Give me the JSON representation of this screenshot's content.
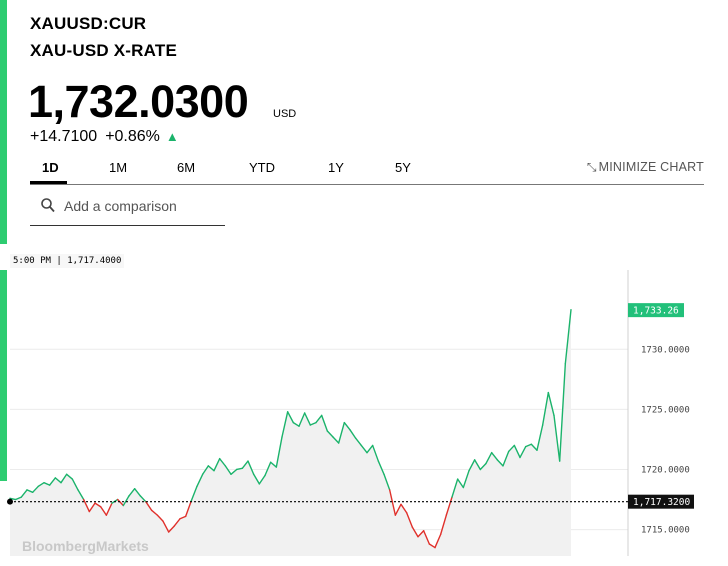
{
  "header": {
    "ticker": "XAUUSD:CUR",
    "name": "XAU-USD X-RATE",
    "price": "1,732.0300",
    "currency": "USD",
    "change": "+14.7100",
    "change_pct": "+0.86%"
  },
  "tabs": [
    {
      "label": "1D",
      "active": true
    },
    {
      "label": "1M"
    },
    {
      "label": "6M"
    },
    {
      "label": "YTD"
    },
    {
      "label": "1Y"
    },
    {
      "label": "5Y"
    }
  ],
  "minimize_chart": "MINIMIZE CHART",
  "compare": {
    "placeholder": "Add a comparison",
    "icon": "search-icon"
  },
  "hover": {
    "time": "5:00 PM",
    "value": "1,717.4000"
  },
  "colors": {
    "accent": "#2ecc71",
    "up": "#1bb36b",
    "down": "#e0312c",
    "last": "#22c07a"
  },
  "chart_data": {
    "type": "line",
    "y_ticks": [
      "1715.0000",
      "1720.0000",
      "1725.0000",
      "1730.0000"
    ],
    "previous_close_label": "1,717.3200",
    "previous_close": 1717.32,
    "last_label": "1,733.26",
    "last": 1733.26,
    "ylim": [
      1712.8,
      1736.6
    ],
    "watermark": "BloombergMarkets",
    "points": [
      1717.6,
      1717.5,
      1717.7,
      1718.3,
      1718.1,
      1718.6,
      1718.9,
      1718.7,
      1719.3,
      1718.9,
      1719.6,
      1719.2,
      1718.3,
      1717.5,
      1716.5,
      1717.2,
      1716.9,
      1716.2,
      1717.2,
      1717.5,
      1717.0,
      1717.8,
      1718.4,
      1717.8,
      1717.3,
      1716.6,
      1716.2,
      1715.7,
      1714.8,
      1715.3,
      1715.9,
      1716.1,
      1717.4,
      1718.6,
      1719.6,
      1720.3,
      1719.9,
      1720.9,
      1720.3,
      1719.6,
      1720.0,
      1720.1,
      1720.7,
      1719.6,
      1718.8,
      1719.5,
      1720.6,
      1720.2,
      1722.7,
      1724.8,
      1723.9,
      1723.6,
      1724.7,
      1723.7,
      1723.9,
      1724.5,
      1723.2,
      1722.7,
      1722.2,
      1723.9,
      1723.3,
      1722.6,
      1722.0,
      1721.4,
      1722.0,
      1720.7,
      1719.6,
      1718.3,
      1716.2,
      1717.1,
      1716.4,
      1715.2,
      1714.4,
      1714.9,
      1713.8,
      1713.5,
      1714.6,
      1716.2,
      1717.7,
      1719.2,
      1718.5,
      1719.9,
      1720.8,
      1720.0,
      1720.5,
      1721.4,
      1720.8,
      1720.3,
      1721.5,
      1722.0,
      1721.0,
      1721.9,
      1722.1,
      1721.6,
      1723.7,
      1726.4,
      1724.5,
      1720.7,
      1728.8,
      1733.3
    ]
  }
}
